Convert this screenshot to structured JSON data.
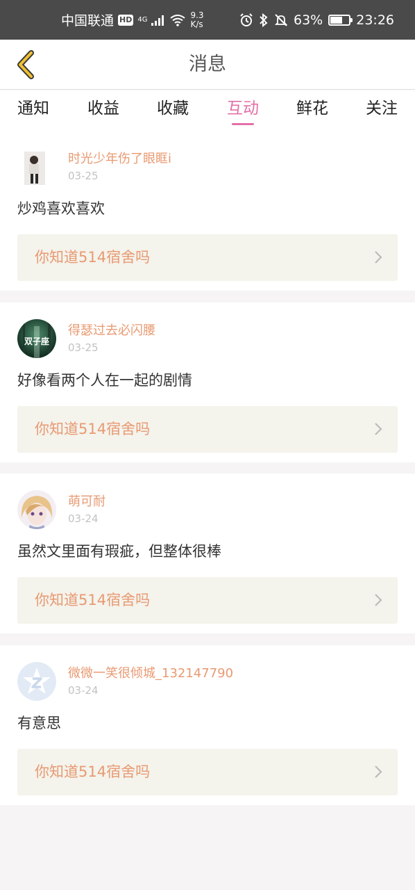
{
  "status_bar": {
    "carrier": "中国联通",
    "hd": "HD",
    "network": "4G",
    "speed_value": "9.3",
    "speed_unit": "K/s",
    "battery": "63%",
    "battery_level": 0.63,
    "time": "23:26"
  },
  "header": {
    "title": "消息",
    "back_icon": "chevron-left-icon"
  },
  "tabs": [
    {
      "label": "通知",
      "active": false
    },
    {
      "label": "收益",
      "active": false
    },
    {
      "label": "收藏",
      "active": false
    },
    {
      "label": "互动",
      "active": true
    },
    {
      "label": "鲜花",
      "active": false
    },
    {
      "label": "关注",
      "active": false
    }
  ],
  "colors": {
    "accent": "#e46fa7",
    "username": "#e89a72",
    "ref_bg": "#f4f3ec",
    "status_bar": "#4a4a4a"
  },
  "messages": [
    {
      "username": "时光少年伤了眼眶i",
      "date": "03-25",
      "comment": "炒鸡喜欢喜欢",
      "ref_title": "你知道514宿舍吗"
    },
    {
      "username": "得瑟过去必闪腰",
      "date": "03-25",
      "comment": "好像看两个人在一起的剧情",
      "ref_title": "你知道514宿舍吗",
      "avatar_text": "双子座"
    },
    {
      "username": "萌可耐",
      "date": "03-24",
      "comment": "虽然文里面有瑕疵，但整体很棒",
      "ref_title": "你知道514宿舍吗"
    },
    {
      "username": "微微一笑很倾城_132147790",
      "date": "03-24",
      "comment": "有意思",
      "ref_title": "你知道514宿舍吗"
    }
  ]
}
